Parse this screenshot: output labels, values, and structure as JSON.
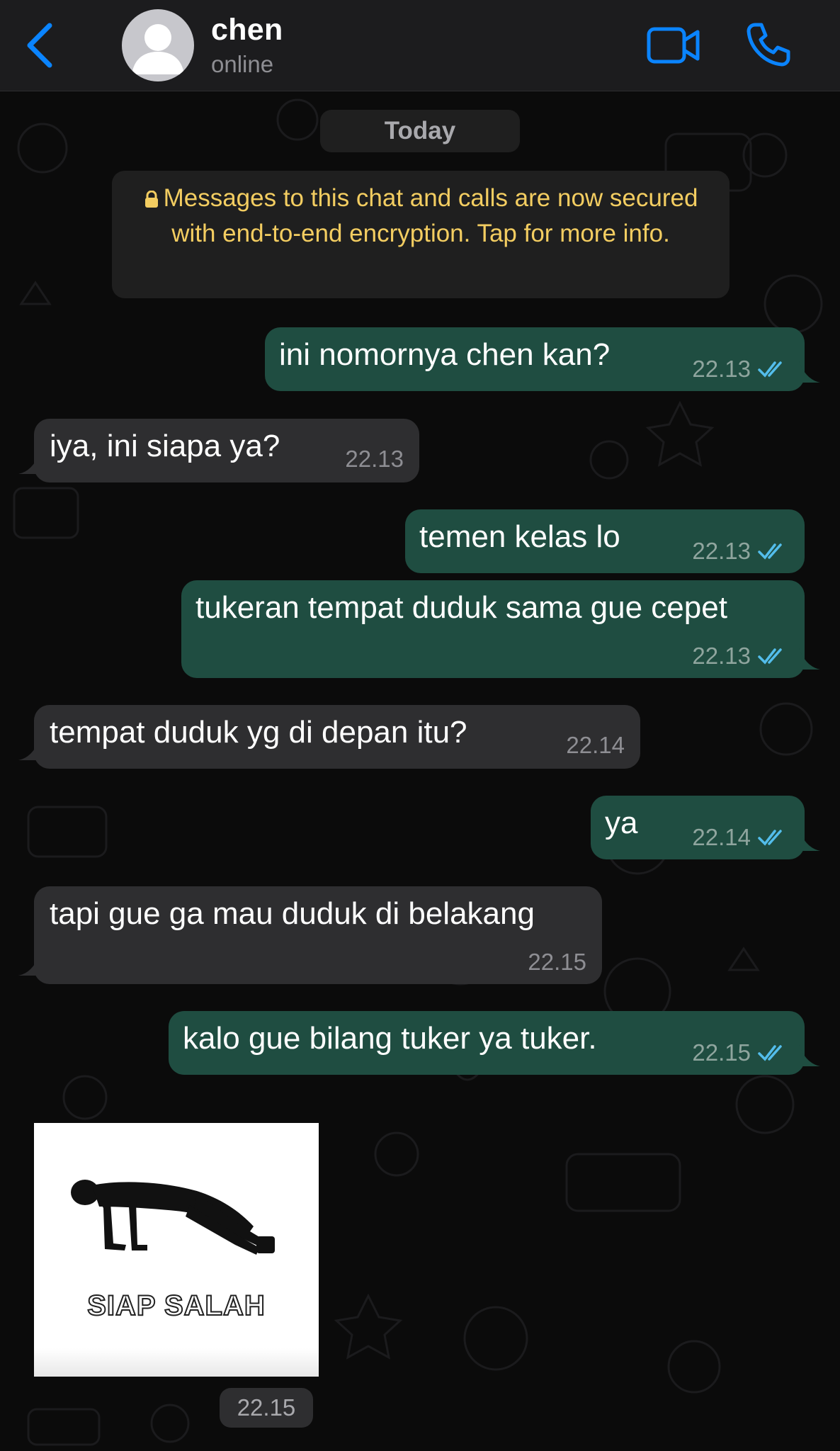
{
  "header": {
    "contact_name": "chen",
    "status": "online",
    "icons": [
      "chevron-left-icon",
      "avatar",
      "video-camera-icon",
      "phone-icon"
    ],
    "accent_color": "#0a84ff"
  },
  "chat": {
    "date_divider": "Today",
    "encryption_notice": "Messages to this chat and calls are now secured with end-to-end encryption. Tap for more info.",
    "notice_color": "#f3cd61",
    "outgoing_bubble_color": "#1f4d41",
    "incoming_bubble_color": "#2e2e30",
    "messages": [
      {
        "direction": "outgoing",
        "text": "ini nomornya chen kan?",
        "time": "22.13",
        "status": "read"
      },
      {
        "direction": "incoming",
        "text": "iya, ini siapa ya?",
        "time": "22.13"
      },
      {
        "direction": "outgoing",
        "text": "temen kelas lo",
        "time": "22.13",
        "status": "read"
      },
      {
        "direction": "outgoing",
        "text": "tukeran tempat duduk sama gue cepet",
        "time": "22.13",
        "status": "read"
      },
      {
        "direction": "incoming",
        "text": "tempat duduk yg di depan itu?",
        "time": "22.14"
      },
      {
        "direction": "outgoing",
        "text": "ya",
        "time": "22.14",
        "status": "read"
      },
      {
        "direction": "incoming",
        "text": "tapi gue ga mau duduk di belakang",
        "time": "22.15"
      },
      {
        "direction": "outgoing",
        "text": "kalo gue bilang tuker ya tuker.",
        "time": "22.15",
        "status": "read"
      }
    ],
    "image_message": {
      "direction": "incoming",
      "caption": "SIAP SALAH",
      "time": "22.15"
    }
  }
}
